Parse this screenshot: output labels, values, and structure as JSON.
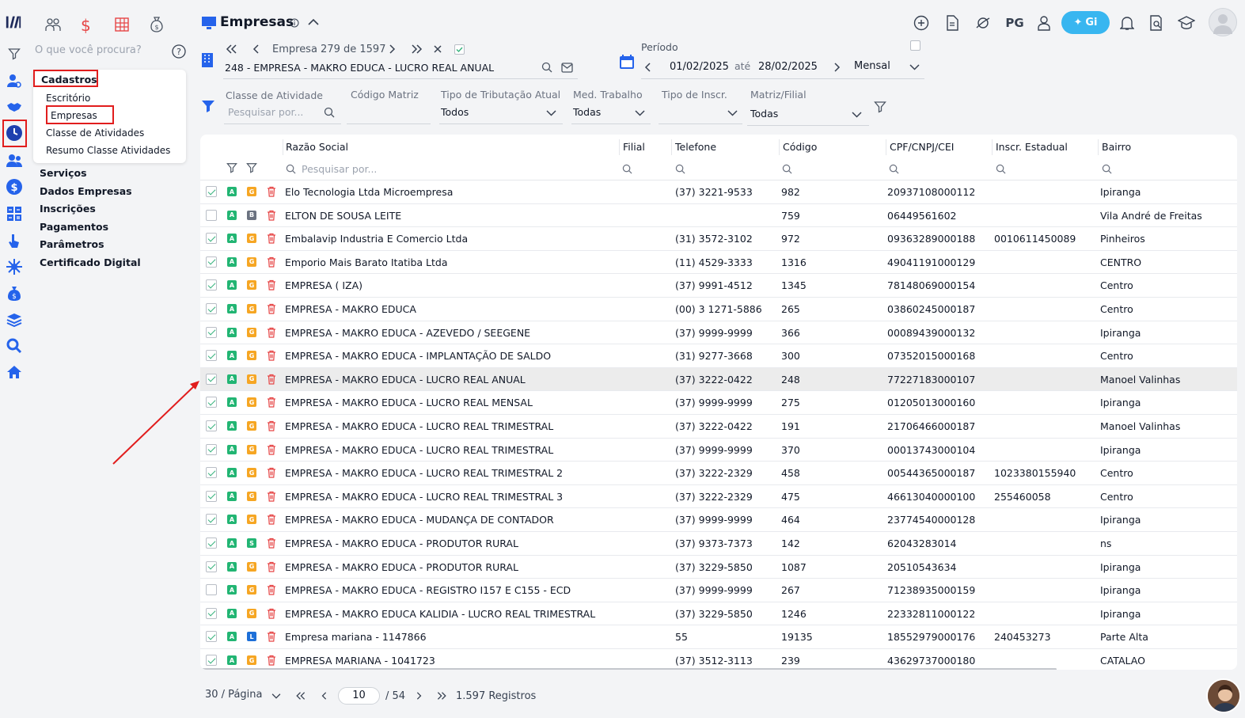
{
  "colors": {
    "brand": "#1e3a8a",
    "accent_blue": "#2563eb",
    "highlight_red": "#e11d1d",
    "badge_green": "#22b573",
    "badge_orange": "#f6a623",
    "badge_gray": "#6b7280",
    "badge_blue": "#1d6fd8",
    "checkbox_green": "#35b27c",
    "trash_red": "#e64545",
    "gi_button": "#38b6f0"
  },
  "sidebar": {
    "search_placeholder": "O que você procura?",
    "section_title": "Cadastros",
    "submenu": [
      "Escritório",
      "Empresas",
      "Classe de Atividades",
      "Resumo Classe Atividades"
    ],
    "items": [
      "Serviços",
      "Dados Empresas",
      "Inscrições",
      "Pagamentos",
      "Parâmetros",
      "Certificado Digital"
    ]
  },
  "header": {
    "title": "Empresas",
    "pg_label": "PG",
    "gi_label": "Gi"
  },
  "company_nav": {
    "label": "Empresa 279 de 1597",
    "current": "248 - EMPRESA - MAKRO EDUCA - LUCRO REAL ANUAL"
  },
  "period": {
    "label": "Período",
    "start": "01/02/2025",
    "separator": "até",
    "end": "28/02/2025",
    "mode": "Mensal"
  },
  "filters": {
    "classe_label": "Classe de Atividade",
    "classe_placeholder": "Pesquisar por...",
    "codigo_label": "Código Matriz",
    "tributacao_label": "Tipo de Tributação Atual",
    "tributacao_value": "Todos",
    "med_label": "Med. Trabalho",
    "med_value": "Todas",
    "inscr_label": "Tipo de Inscr.",
    "matriz_label": "Matriz/Filial",
    "matriz_value": "Todas"
  },
  "table": {
    "columns": [
      "Razão Social",
      "Filial",
      "Telefone",
      "Código",
      "CPF/CNPJ/CEI",
      "Inscr. Estadual",
      "Bairro"
    ],
    "search_placeholder": "Pesquisar por...",
    "rows": [
      {
        "checked": true,
        "badge2": "G",
        "razao": "Elo Tecnologia Ltda Microempresa",
        "telefone": "(37) 3221-9533",
        "codigo": "982",
        "cnpj": "20937108000112",
        "ie": "",
        "bairro": "Ipiranga"
      },
      {
        "checked": false,
        "badge2": "B",
        "razao": "ELTON DE SOUSA LEITE",
        "telefone": "",
        "codigo": "759",
        "cnpj": "06449561602",
        "ie": "",
        "bairro": "Vila André de Freitas"
      },
      {
        "checked": true,
        "badge2": "G",
        "razao": "Embalavip Industria E Comercio Ltda",
        "telefone": "(31) 3572-3102",
        "codigo": "972",
        "cnpj": "09363289000188",
        "ie": "0010611450089",
        "bairro": "Pinheiros"
      },
      {
        "checked": true,
        "badge2": "G",
        "razao": "Emporio Mais Barato Itatiba Ltda",
        "telefone": "(11) 4529-3333",
        "codigo": "1316",
        "cnpj": "49041191000129",
        "ie": "",
        "bairro": "CENTRO"
      },
      {
        "checked": true,
        "badge2": "G",
        "razao": "EMPRESA ( IZA)",
        "telefone": "(37) 9991-4512",
        "codigo": "1345",
        "cnpj": "78148069000154",
        "ie": "",
        "bairro": "Centro"
      },
      {
        "checked": true,
        "badge2": "G",
        "razao": "EMPRESA - MAKRO EDUCA",
        "telefone": "(00) 3 1271-5886",
        "codigo": "265",
        "cnpj": "03860245000187",
        "ie": "",
        "bairro": "Centro"
      },
      {
        "checked": true,
        "badge2": "G",
        "razao": "EMPRESA - MAKRO EDUCA - AZEVEDO / SEEGENE",
        "telefone": "(37) 9999-9999",
        "codigo": "366",
        "cnpj": "00089439000132",
        "ie": "",
        "bairro": "Ipiranga"
      },
      {
        "checked": true,
        "badge2": "G",
        "razao": "EMPRESA - MAKRO EDUCA - IMPLANTAÇÃO DE SALDO",
        "telefone": "(31) 9277-3668",
        "codigo": "300",
        "cnpj": "07352015000168",
        "ie": "",
        "bairro": "Centro"
      },
      {
        "checked": true,
        "badge2": "G",
        "razao": "EMPRESA - MAKRO EDUCA - LUCRO REAL ANUAL",
        "telefone": "(37) 3222-0422",
        "codigo": "248",
        "cnpj": "77227183000107",
        "ie": "",
        "bairro": "Manoel Valinhas",
        "selected": true
      },
      {
        "checked": true,
        "badge2": "G",
        "razao": "EMPRESA - MAKRO EDUCA - LUCRO REAL MENSAL",
        "telefone": "(37) 9999-9999",
        "codigo": "275",
        "cnpj": "01205013000160",
        "ie": "",
        "bairro": "Ipiranga"
      },
      {
        "checked": true,
        "badge2": "G",
        "razao": "EMPRESA - MAKRO EDUCA - LUCRO REAL TRIMESTRAL",
        "telefone": "(37) 3222-0422",
        "codigo": "191",
        "cnpj": "21706466000187",
        "ie": "",
        "bairro": "Manoel Valinhas"
      },
      {
        "checked": true,
        "badge2": "G",
        "razao": "EMPRESA - MAKRO EDUCA - LUCRO REAL TRIMESTRAL",
        "telefone": "(37) 9999-9999",
        "codigo": "370",
        "cnpj": "00013743000104",
        "ie": "",
        "bairro": "Ipiranga"
      },
      {
        "checked": true,
        "badge2": "G",
        "razao": "EMPRESA - MAKRO EDUCA - LUCRO REAL TRIMESTRAL 2",
        "telefone": "(37) 3222-2329",
        "codigo": "458",
        "cnpj": "00544365000187",
        "ie": "1023380155940",
        "bairro": "Centro"
      },
      {
        "checked": true,
        "badge2": "G",
        "razao": "EMPRESA - MAKRO EDUCA - LUCRO REAL TRIMESTRAL 3",
        "telefone": "(37) 3222-2329",
        "codigo": "475",
        "cnpj": "46613040000100",
        "ie": "255460058",
        "bairro": "Centro"
      },
      {
        "checked": true,
        "badge2": "G",
        "razao": "EMPRESA - MAKRO EDUCA - MUDANÇA DE CONTADOR",
        "telefone": "(37) 9999-9999",
        "codigo": "464",
        "cnpj": "23774540000128",
        "ie": "",
        "bairro": "Ipiranga"
      },
      {
        "checked": true,
        "badge2": "S",
        "razao": "EMPRESA - MAKRO EDUCA - PRODUTOR RURAL",
        "telefone": "(37) 9373-7373",
        "codigo": "142",
        "cnpj": "62043283014",
        "ie": "",
        "bairro": "ns"
      },
      {
        "checked": true,
        "badge2": "G",
        "razao": "EMPRESA - MAKRO EDUCA - PRODUTOR RURAL",
        "telefone": "(37) 3229-5850",
        "codigo": "1087",
        "cnpj": "20510543634",
        "ie": "",
        "bairro": "Ipiranga"
      },
      {
        "checked": false,
        "badge2": "G",
        "razao": "EMPRESA - MAKRO EDUCA - REGISTRO I157 E C155 - ECD",
        "telefone": "(37) 9999-9999",
        "codigo": "267",
        "cnpj": "71238935000159",
        "ie": "",
        "bairro": "Ipiranga"
      },
      {
        "checked": true,
        "badge2": "G",
        "razao": "EMPRESA - MAKRO EDUCA KALIDIA - LUCRO REAL TRIMESTRAL",
        "telefone": "(37) 3229-5850",
        "codigo": "1246",
        "cnpj": "22332811000122",
        "ie": "",
        "bairro": "Ipiranga"
      },
      {
        "checked": true,
        "badge2": "L",
        "razao": "Empresa mariana - 1147866",
        "telefone": "55",
        "codigo": "19135",
        "cnpj": "18552979000176",
        "ie": "240453273",
        "bairro": "Parte Alta"
      },
      {
        "checked": true,
        "badge2": "G",
        "razao": "EMPRESA MARIANA - 1041723",
        "telefone": "(37) 3512-3113",
        "codigo": "239",
        "cnpj": "43629737000180",
        "ie": "",
        "bairro": "CATALAO"
      }
    ]
  },
  "pagination": {
    "per_page": "30 / Página",
    "current_page": "10",
    "total_pages": "/ 54",
    "records": "1.597 Registros"
  }
}
